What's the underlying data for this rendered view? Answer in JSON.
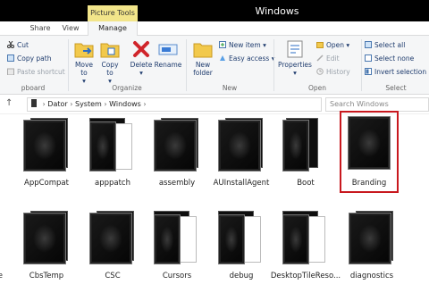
{
  "window": {
    "title": "Windows",
    "contextual_tab": "Picture Tools"
  },
  "tabs": [
    {
      "label": "Share"
    },
    {
      "label": "View"
    },
    {
      "label": "Manage"
    }
  ],
  "ribbon": {
    "clipboard": {
      "cut": "Cut",
      "copy_path": "Copy path",
      "paste_shortcut": "Paste shortcut",
      "group_label": "pboard"
    },
    "organize": {
      "move_to": "Move to",
      "copy_to": "Copy to",
      "delete": "Delete",
      "rename": "Rename",
      "group_label": "Organize"
    },
    "new": {
      "new_folder": "New folder",
      "new_item": "New item",
      "easy_access": "Easy access",
      "group_label": "New"
    },
    "open": {
      "properties": "Properties",
      "open": "Open",
      "edit": "Edit",
      "history": "History",
      "group_label": "Open"
    },
    "select": {
      "select_all": "Select all",
      "select_none": "Select none",
      "invert_selection": "Invert selection",
      "group_label": "Select"
    }
  },
  "address": {
    "crumbs": [
      "Dator",
      "System",
      "Windows"
    ],
    "search_placeholder": "Search Windows"
  },
  "items_row1": [
    {
      "name": "AppCompat"
    },
    {
      "name": "apppatch"
    },
    {
      "name": "assembly"
    },
    {
      "name": "AUInstallAgent"
    },
    {
      "name": "Boot"
    },
    {
      "name": "Branding"
    }
  ],
  "items_row2": [
    {
      "name": "ce"
    },
    {
      "name": "CbsTemp"
    },
    {
      "name": "CSC"
    },
    {
      "name": "Cursors"
    },
    {
      "name": "debug"
    },
    {
      "name": "DesktopTileReso..."
    },
    {
      "name": "diagnostics"
    }
  ]
}
